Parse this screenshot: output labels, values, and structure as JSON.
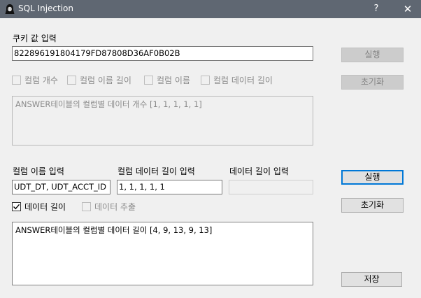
{
  "window": {
    "title": "SQL Injection",
    "help_glyph": "?",
    "close_glyph": "✕"
  },
  "cookie": {
    "label": "쿠키 값 입력",
    "value": "822896191804179FD87808D36AF0B02B",
    "run_label": "실행",
    "reset_label": "초기화"
  },
  "column_options": [
    {
      "label": "컬럼 개수",
      "checked": false
    },
    {
      "label": "컬럼 이름 길이",
      "checked": false
    },
    {
      "label": "컬럼 이름",
      "checked": false
    },
    {
      "label": "컬럼 데이터 길이",
      "checked": false
    }
  ],
  "result_top": "ANSWER테이블의 컬럼별 데이터 개수 [1, 1, 1, 1, 1]",
  "data": {
    "col_name_label": "컬럼 이름 입력",
    "col_name_value": "UDT_DT, UDT_ACCT_ID",
    "data_len_label": "컬럼 데이터 길이 입력",
    "data_len_value": "1, 1, 1, 1, 1",
    "str_len_label": "데이터 길이 입력",
    "str_len_value": "",
    "run_label": "실행",
    "reset_label": "초기화",
    "opt_length": {
      "label": "데이터 길이",
      "checked": true
    },
    "opt_extract": {
      "label": "데이터 추출",
      "checked": false
    }
  },
  "result_bottom": "ANSWER테이블의 컬럼별 데이터 길이 [4, 9, 13, 9, 13]",
  "save_label": "저장"
}
